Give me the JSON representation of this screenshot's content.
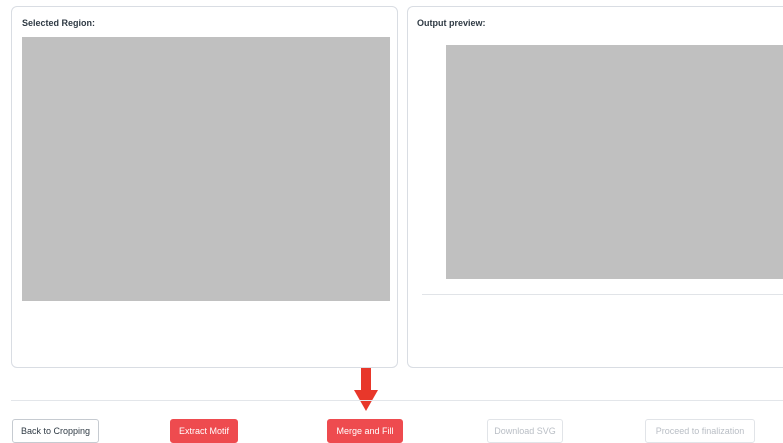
{
  "left_panel": {
    "title": "Selected Region:"
  },
  "right_panel": {
    "title": "Output preview:"
  },
  "annotation": {
    "icon": "arrow-down-icon",
    "color": "#e8372a"
  },
  "buttons": {
    "back": "Back to Cropping",
    "extract": "Extract Motif",
    "merge": "Merge and Fill",
    "download": "Download SVG",
    "proceed": "Proceed to finalization"
  },
  "colors": {
    "primary": "#ee4b4f",
    "placeholder": "#c0c0c0"
  }
}
